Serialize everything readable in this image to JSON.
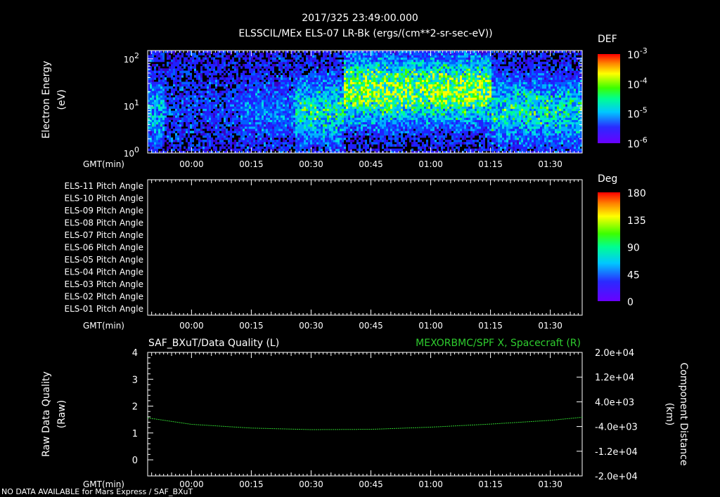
{
  "header": {
    "line1": "2017/325 23:49:00.000",
    "line2": "ELSSCIL/MEx ELS-07 LR-Bk  (ergs/(cm**2-sr-sec-eV))"
  },
  "footer": "NO DATA AVAILABLE for Mars Express / SAF_BXuT",
  "colors": {
    "background": "#000000",
    "foreground": "#ffffff",
    "right_series": "#2ecc2e"
  },
  "chart_data": [
    {
      "type": "heatmap",
      "name": "spectrogram",
      "ylabel": [
        "Electron Energy",
        "(eV)"
      ],
      "xlabel": "GMT(min)",
      "x_ticks": [
        "00:00",
        "00:15",
        "00:30",
        "00:45",
        "01:00",
        "01:15",
        "01:30"
      ],
      "y_ticks": [
        {
          "base": "10",
          "exp": "0"
        },
        {
          "base": "10",
          "exp": "1"
        },
        {
          "base": "10",
          "exp": "2"
        }
      ],
      "ylim": [
        1,
        150
      ],
      "yscale": "log",
      "colorbar": {
        "title": "DEF",
        "ticks": [
          {
            "base": "10",
            "exp": "-3"
          },
          {
            "base": "10",
            "exp": "-4"
          },
          {
            "base": "10",
            "exp": "-5"
          },
          {
            "base": "10",
            "exp": "-6"
          }
        ],
        "scale": "log",
        "range": [
          1e-06,
          0.001
        ]
      }
    },
    {
      "type": "heatmap",
      "name": "pitch-angle",
      "xlabel": "GMT(min)",
      "x_ticks": [
        "00:00",
        "00:15",
        "00:30",
        "00:45",
        "01:00",
        "01:15",
        "01:30"
      ],
      "rows": [
        "ELS-11 Pitch Angle",
        "ELS-10 Pitch Angle",
        "ELS-09 Pitch Angle",
        "ELS-08 Pitch Angle",
        "ELS-07 Pitch Angle",
        "ELS-06 Pitch Angle",
        "ELS-05 Pitch Angle",
        "ELS-04 Pitch Angle",
        "ELS-03 Pitch Angle",
        "ELS-02 Pitch Angle",
        "ELS-01 Pitch Angle"
      ],
      "colorbar": {
        "title": "Deg",
        "ticks": [
          "180",
          "135",
          "90",
          "45",
          "0"
        ],
        "range": [
          0,
          180
        ]
      }
    },
    {
      "type": "line",
      "name": "data-quality",
      "title_left": "SAF_BXuT/Data Quality (L)",
      "title_right": "MEXORBMC/SPF X, Spacecraft (R)",
      "ylabel_left": [
        "Raw Data Quality",
        "(Raw)"
      ],
      "ylabel_right": [
        "Component Distance",
        "(km)"
      ],
      "xlabel": "GMT(min)",
      "x_ticks": [
        "00:00",
        "00:15",
        "00:30",
        "00:45",
        "01:00",
        "01:15",
        "01:30"
      ],
      "y_left_ticks": [
        "0",
        "1",
        "2",
        "3",
        "4"
      ],
      "ylim_left": [
        -0.6,
        4
      ],
      "y_right_ticks": [
        "-2.0e+04",
        "-1.2e+04",
        "-4.0e+03",
        "4.0e+03",
        "1.2e+04",
        "2.0e+04"
      ],
      "ylim_right": [
        -20000,
        20000
      ],
      "series": [
        {
          "name": "MEXORBMC/SPF X, Spacecraft (R)",
          "axis": "right",
          "x_min": [
            -11,
            0,
            15,
            30,
            45,
            60,
            75,
            90,
            98
          ],
          "y": [
            -1200,
            -3300,
            -4500,
            -5000,
            -4900,
            -4200,
            -3200,
            -2000,
            -1000
          ]
        }
      ]
    }
  ]
}
